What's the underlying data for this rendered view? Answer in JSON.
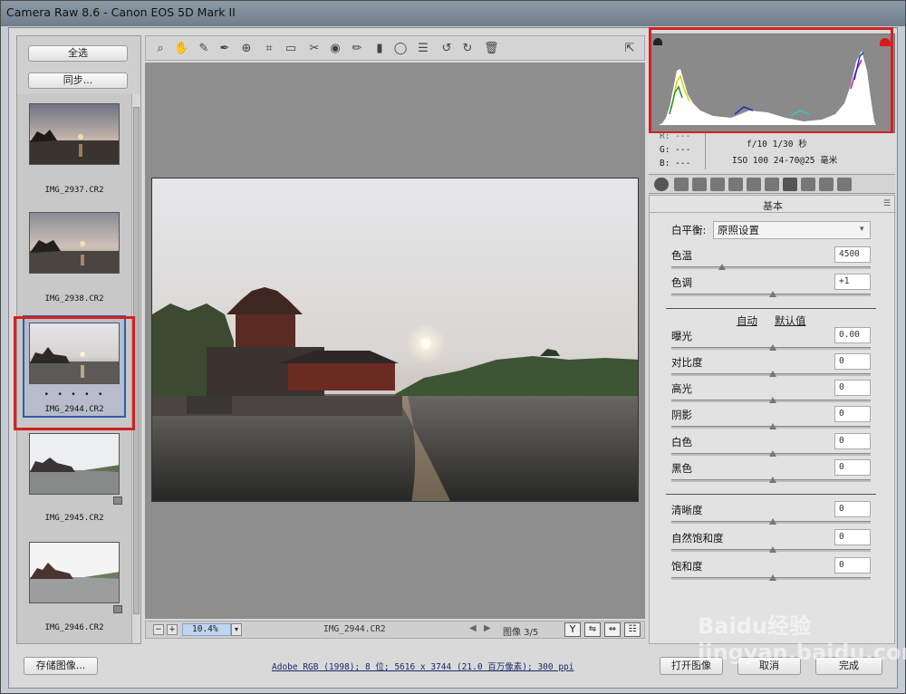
{
  "window": {
    "title": "Camera Raw 8.6 -  Canon EOS 5D Mark II"
  },
  "filmstrip": {
    "select_all": "全选",
    "sync": "同步...",
    "items": [
      {
        "name": "IMG_2937.CR2"
      },
      {
        "name": "IMG_2938.CR2"
      },
      {
        "name": "IMG_2944.CR2",
        "selected": true,
        "dots": "• • • • •"
      },
      {
        "name": "IMG_2945.CR2"
      },
      {
        "name": "IMG_2946.CR2"
      }
    ]
  },
  "toolbar": {
    "icons": [
      "zoom-icon",
      "hand-icon",
      "white-balance-icon",
      "color-sampler-icon",
      "target-adjust-icon",
      "crop-icon",
      "straighten-icon",
      "spot-removal-icon",
      "red-eye-icon",
      "adjustment-brush-icon",
      "graduated-filter-icon",
      "radial-filter-icon",
      "preferences-icon",
      "rotate-left-icon",
      "rotate-right-icon",
      "trash-icon"
    ]
  },
  "bottombar": {
    "zoom": "10.4%",
    "filename": "IMG_2944.CR2",
    "image_counter": "图像 3/5"
  },
  "info": {
    "r": "R:  ---",
    "g": "G:  ---",
    "b": "B:  ---",
    "aperture_shutter": "f/10   1/30 秒",
    "iso_lens": "ISO 100   24-70@25 毫米"
  },
  "panel": {
    "title": "基本",
    "white_balance_label": "白平衡:",
    "white_balance_value": "原照设置",
    "temp_label": "色温",
    "temp_value": "4500",
    "tint_label": "色调",
    "tint_value": "+1",
    "auto": "自动",
    "default": "默认值",
    "exposure_label": "曝光",
    "exposure_value": "0.00",
    "contrast_label": "对比度",
    "contrast_value": "0",
    "highlights_label": "高光",
    "highlights_value": "0",
    "shadows_label": "阴影",
    "shadows_value": "0",
    "whites_label": "白色",
    "whites_value": "0",
    "blacks_label": "黑色",
    "blacks_value": "0",
    "clarity_label": "清晰度",
    "clarity_value": "0",
    "vibrance_label": "自然饱和度",
    "vibrance_value": "0",
    "saturation_label": "饱和度",
    "saturation_value": "0"
  },
  "footer": {
    "save": "存储图像...",
    "workflow": "Adobe RGB (1998); 8 位; 5616 x 3744 (21.0 百万像素); 300 ppi",
    "open": "打开图像",
    "cancel": "取消",
    "done": "完成"
  },
  "watermark": "Baidu经验 jingyan.baidu.com",
  "colors": {
    "highlight_red": "#d62020",
    "selected_blue": "#2c5fa8"
  }
}
